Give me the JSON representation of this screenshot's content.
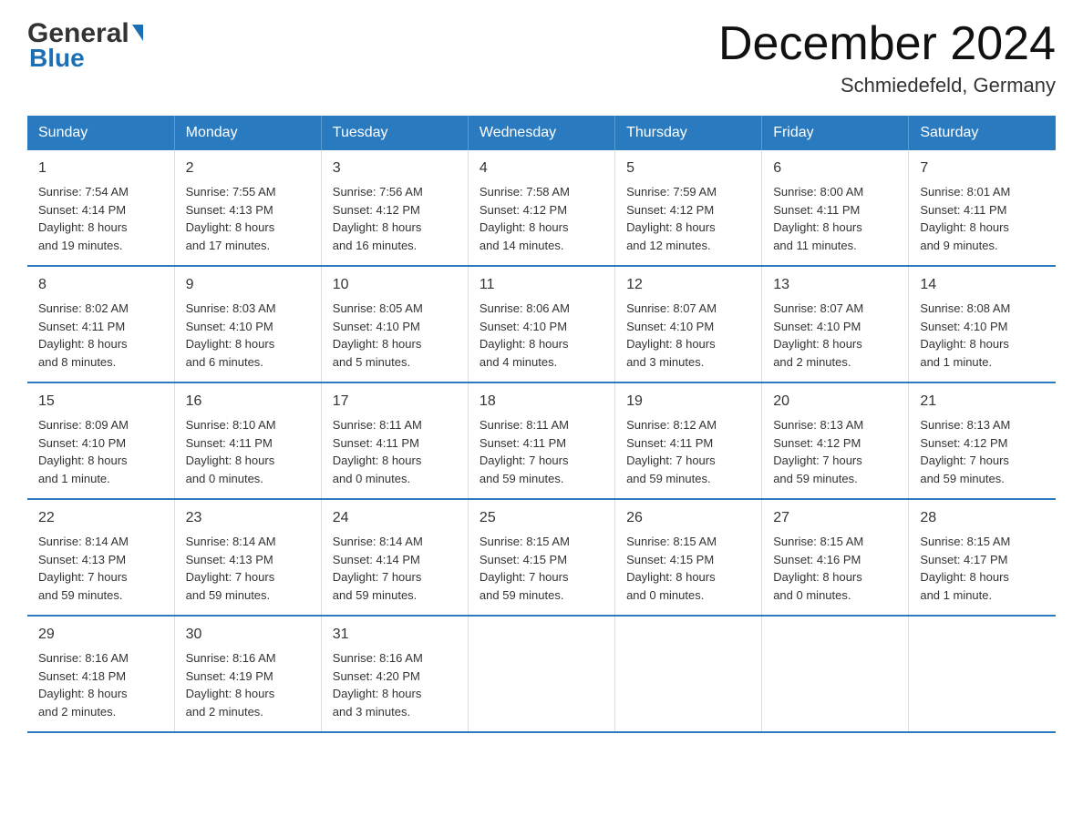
{
  "header": {
    "logo_general": "General",
    "logo_blue": "Blue",
    "month_year": "December 2024",
    "location": "Schmiedefeld, Germany"
  },
  "weekdays": [
    "Sunday",
    "Monday",
    "Tuesday",
    "Wednesday",
    "Thursday",
    "Friday",
    "Saturday"
  ],
  "weeks": [
    [
      {
        "day": "1",
        "sunrise": "7:54 AM",
        "sunset": "4:14 PM",
        "daylight": "8 hours and 19 minutes."
      },
      {
        "day": "2",
        "sunrise": "7:55 AM",
        "sunset": "4:13 PM",
        "daylight": "8 hours and 17 minutes."
      },
      {
        "day": "3",
        "sunrise": "7:56 AM",
        "sunset": "4:12 PM",
        "daylight": "8 hours and 16 minutes."
      },
      {
        "day": "4",
        "sunrise": "7:58 AM",
        "sunset": "4:12 PM",
        "daylight": "8 hours and 14 minutes."
      },
      {
        "day": "5",
        "sunrise": "7:59 AM",
        "sunset": "4:12 PM",
        "daylight": "8 hours and 12 minutes."
      },
      {
        "day": "6",
        "sunrise": "8:00 AM",
        "sunset": "4:11 PM",
        "daylight": "8 hours and 11 minutes."
      },
      {
        "day": "7",
        "sunrise": "8:01 AM",
        "sunset": "4:11 PM",
        "daylight": "8 hours and 9 minutes."
      }
    ],
    [
      {
        "day": "8",
        "sunrise": "8:02 AM",
        "sunset": "4:11 PM",
        "daylight": "8 hours and 8 minutes."
      },
      {
        "day": "9",
        "sunrise": "8:03 AM",
        "sunset": "4:10 PM",
        "daylight": "8 hours and 6 minutes."
      },
      {
        "day": "10",
        "sunrise": "8:05 AM",
        "sunset": "4:10 PM",
        "daylight": "8 hours and 5 minutes."
      },
      {
        "day": "11",
        "sunrise": "8:06 AM",
        "sunset": "4:10 PM",
        "daylight": "8 hours and 4 minutes."
      },
      {
        "day": "12",
        "sunrise": "8:07 AM",
        "sunset": "4:10 PM",
        "daylight": "8 hours and 3 minutes."
      },
      {
        "day": "13",
        "sunrise": "8:07 AM",
        "sunset": "4:10 PM",
        "daylight": "8 hours and 2 minutes."
      },
      {
        "day": "14",
        "sunrise": "8:08 AM",
        "sunset": "4:10 PM",
        "daylight": "8 hours and 1 minute."
      }
    ],
    [
      {
        "day": "15",
        "sunrise": "8:09 AM",
        "sunset": "4:10 PM",
        "daylight": "8 hours and 1 minute."
      },
      {
        "day": "16",
        "sunrise": "8:10 AM",
        "sunset": "4:11 PM",
        "daylight": "8 hours and 0 minutes."
      },
      {
        "day": "17",
        "sunrise": "8:11 AM",
        "sunset": "4:11 PM",
        "daylight": "8 hours and 0 minutes."
      },
      {
        "day": "18",
        "sunrise": "8:11 AM",
        "sunset": "4:11 PM",
        "daylight": "7 hours and 59 minutes."
      },
      {
        "day": "19",
        "sunrise": "8:12 AM",
        "sunset": "4:11 PM",
        "daylight": "7 hours and 59 minutes."
      },
      {
        "day": "20",
        "sunrise": "8:13 AM",
        "sunset": "4:12 PM",
        "daylight": "7 hours and 59 minutes."
      },
      {
        "day": "21",
        "sunrise": "8:13 AM",
        "sunset": "4:12 PM",
        "daylight": "7 hours and 59 minutes."
      }
    ],
    [
      {
        "day": "22",
        "sunrise": "8:14 AM",
        "sunset": "4:13 PM",
        "daylight": "7 hours and 59 minutes."
      },
      {
        "day": "23",
        "sunrise": "8:14 AM",
        "sunset": "4:13 PM",
        "daylight": "7 hours and 59 minutes."
      },
      {
        "day": "24",
        "sunrise": "8:14 AM",
        "sunset": "4:14 PM",
        "daylight": "7 hours and 59 minutes."
      },
      {
        "day": "25",
        "sunrise": "8:15 AM",
        "sunset": "4:15 PM",
        "daylight": "7 hours and 59 minutes."
      },
      {
        "day": "26",
        "sunrise": "8:15 AM",
        "sunset": "4:15 PM",
        "daylight": "8 hours and 0 minutes."
      },
      {
        "day": "27",
        "sunrise": "8:15 AM",
        "sunset": "4:16 PM",
        "daylight": "8 hours and 0 minutes."
      },
      {
        "day": "28",
        "sunrise": "8:15 AM",
        "sunset": "4:17 PM",
        "daylight": "8 hours and 1 minute."
      }
    ],
    [
      {
        "day": "29",
        "sunrise": "8:16 AM",
        "sunset": "4:18 PM",
        "daylight": "8 hours and 2 minutes."
      },
      {
        "day": "30",
        "sunrise": "8:16 AM",
        "sunset": "4:19 PM",
        "daylight": "8 hours and 2 minutes."
      },
      {
        "day": "31",
        "sunrise": "8:16 AM",
        "sunset": "4:20 PM",
        "daylight": "8 hours and 3 minutes."
      },
      null,
      null,
      null,
      null
    ]
  ],
  "labels": {
    "sunrise": "Sunrise:",
    "sunset": "Sunset:",
    "daylight": "Daylight:"
  }
}
